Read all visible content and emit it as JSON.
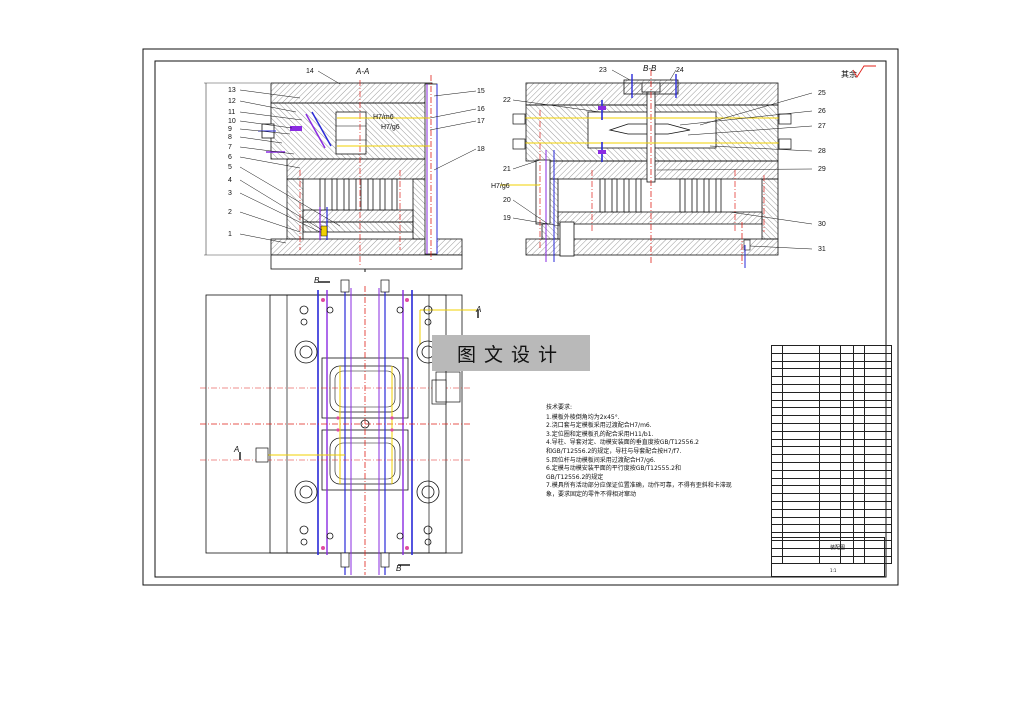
{
  "sections": {
    "aa": "A-A",
    "bb": "B-B",
    "b_top": "B",
    "b_bottom": "B",
    "a_right": "A",
    "a_left": "A"
  },
  "fits": {
    "h7m6": "H7/m6",
    "h7g6_a": "H7/g6",
    "h7g6_b": "H7/g6"
  },
  "roughness": {
    "label": "其余",
    "symbol": "roughness-symbol"
  },
  "part_numbers_left": [
    "14",
    "13",
    "12",
    "11",
    "10",
    "9",
    "8",
    "7",
    "6",
    "5",
    "4",
    "3",
    "2",
    "1"
  ],
  "part_numbers_mid": [
    "15",
    "16",
    "17",
    "18"
  ],
  "part_numbers_right_top": [
    "23",
    "24"
  ],
  "part_numbers_right_left": [
    "22",
    "21",
    "20",
    "19"
  ],
  "part_numbers_right": [
    "25",
    "26",
    "27",
    "28",
    "29",
    "30",
    "31"
  ],
  "watermark": "图文设计",
  "notes": {
    "title": "技术要求:",
    "lines": [
      "1.模板外棱倒角均为2x45°.",
      "2.浇口套与定模板采用过渡配合H7/m6.",
      "3.定位圈和定模板孔的配合采用H11/b1.",
      "4.导柱、导套对定、动模安装面的垂直度按GB/T12556.2",
      "和GB/T12556.2的规定，导柱与导套配合按H7/f7.",
      "5.回位杆与动模板间采用过渡配合H7/g6.",
      "6.定模与动模安装平面的平行度按GB/T12555.2和",
      "GB/T12556.2的规定",
      "7.模具所有活动部分应保证位置准确，动作可靠，不得有歪斜和卡滞现象，要求固定的零件不得相对窜动"
    ]
  },
  "title_block": {
    "name": "装配图",
    "scale": "1:1"
  },
  "colors": {
    "ink": "#111111",
    "hatch": "#555555",
    "red": "#e0201a",
    "blue": "#2a2ad8",
    "purple": "#8a2be2",
    "yellow": "#f0d000",
    "grey_fill": "#b9b9b9"
  }
}
